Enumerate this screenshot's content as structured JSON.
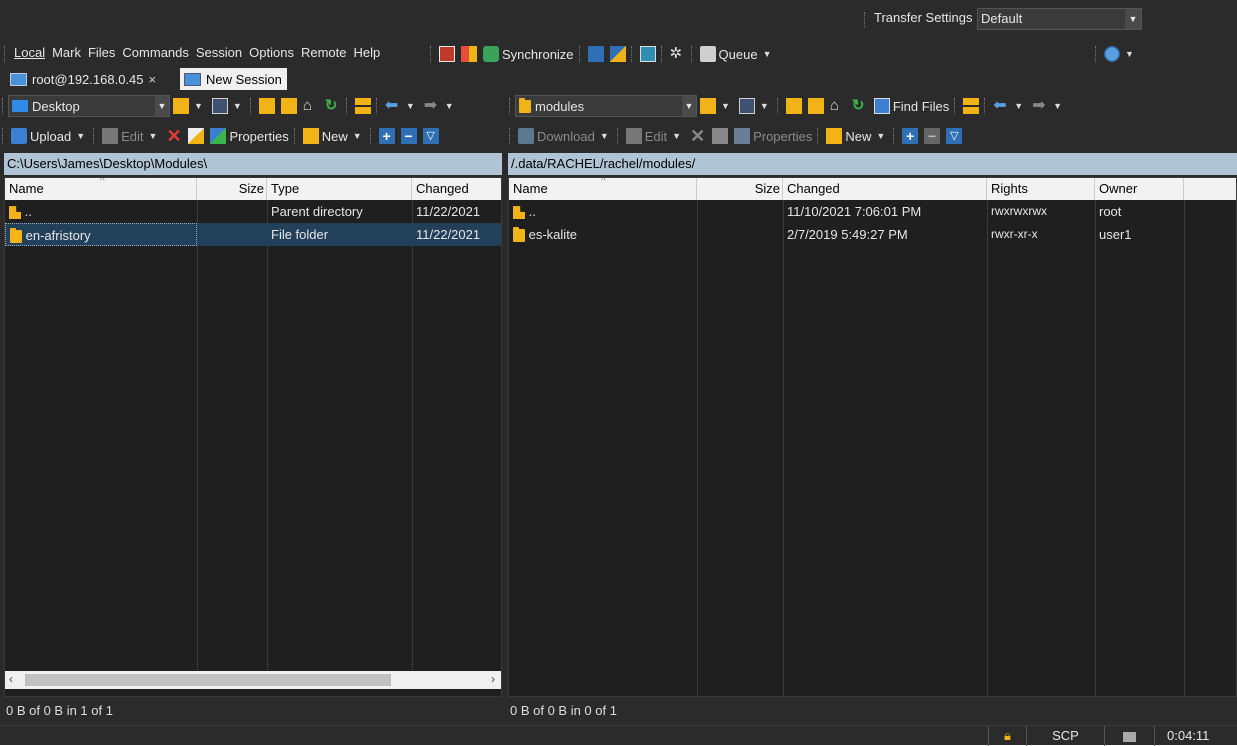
{
  "transfer_settings": {
    "label": "Transfer Settings",
    "value": "Default"
  },
  "menu": [
    "Local",
    "Mark",
    "Files",
    "Commands",
    "Session",
    "Options",
    "Remote",
    "Help"
  ],
  "toolbar": {
    "synchronize": "Synchronize",
    "queue": "Queue"
  },
  "tabs": [
    {
      "label": "root@192.168.0.45",
      "close": "×"
    },
    {
      "label": "New Session"
    }
  ],
  "local": {
    "drive": "Desktop",
    "actions": {
      "upload": "Upload",
      "edit": "Edit",
      "properties": "Properties",
      "new": "New"
    },
    "path": "C:\\Users\\James\\Desktop\\Modules\\",
    "columns": [
      "Name",
      "Size",
      "Type",
      "Changed"
    ],
    "rows": [
      {
        "name": "..",
        "size": "",
        "type": "Parent directory",
        "changed": "11/22/2021"
      },
      {
        "name": "en-afristory",
        "size": "",
        "type": "File folder",
        "changed": "11/22/2021"
      }
    ],
    "status": "0 B of 0 B in 1 of 1"
  },
  "remote": {
    "drive": "modules",
    "find_files": "Find Files",
    "actions": {
      "download": "Download",
      "edit": "Edit",
      "properties": "Properties",
      "new": "New"
    },
    "path": "/.data/RACHEL/rachel/modules/",
    "columns": [
      "Name",
      "Size",
      "Changed",
      "Rights",
      "Owner"
    ],
    "rows": [
      {
        "name": "..",
        "size": "",
        "changed": "11/10/2021 7:06:01 PM",
        "rights": "rwxrwxrwx",
        "owner": "root"
      },
      {
        "name": "es-kalite",
        "size": "",
        "changed": "2/7/2019 5:49:27 PM",
        "rights": "rwxr-xr-x",
        "owner": "user1"
      }
    ],
    "status": "0 B of 0 B in 0 of 1"
  },
  "statusbar": {
    "protocol": "SCP",
    "time": "0:04:11"
  },
  "colors": {
    "background": "#1f1f1f",
    "toolbar": "#2b2b2b",
    "selected_row": "#23405a",
    "path_bar": "#b0c4d6",
    "folder": "#f2b316"
  }
}
